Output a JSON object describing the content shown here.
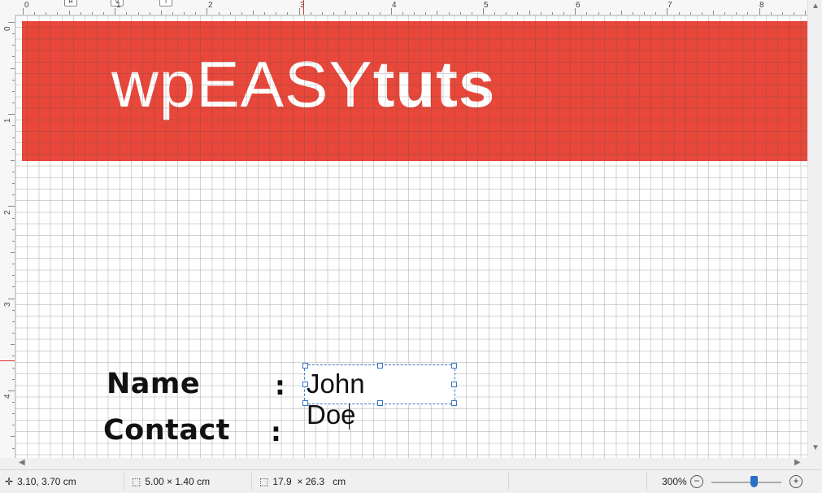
{
  "ruler": {
    "top_numbers": [
      "0",
      "1",
      "2",
      "3",
      "4",
      "5",
      "6",
      "7",
      "8"
    ],
    "left_numbers": [
      "0",
      "1",
      "2",
      "3",
      "4"
    ],
    "markers": [
      "H",
      "V",
      "T"
    ]
  },
  "document": {
    "logo_light": "wpEASY",
    "logo_bold": "tuts",
    "name_label": "Name",
    "contact_label": "Contact",
    "colon": ":",
    "name_value": "John Doe"
  },
  "status": {
    "position": "3.10, 3.70 cm",
    "size": "5.00 × 1.40 cm",
    "page": "17.9  × 26.3   cm",
    "zoom": "300%",
    "zoom_minus": "−",
    "zoom_plus": "+"
  },
  "colors": {
    "banner": "#e8473a",
    "selection": "#3a78c6",
    "zoom_thumb": "#2a6fc9"
  }
}
